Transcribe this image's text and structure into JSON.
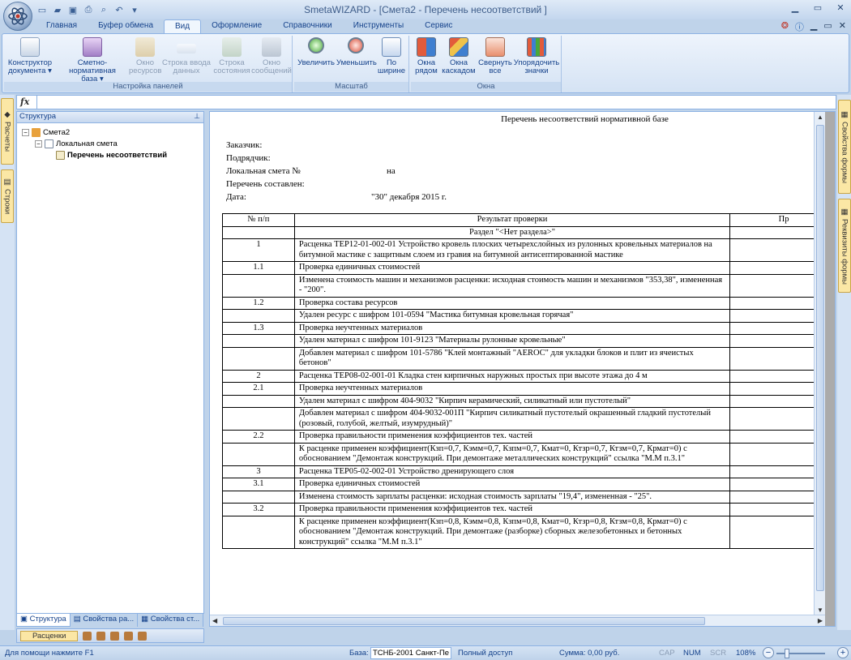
{
  "app": {
    "title": "SmetaWIZARD - [Смета2 - Перечень несоответствий ]"
  },
  "ribbon_tabs": [
    "Главная",
    "Буфер обмена",
    "Вид",
    "Оформление",
    "Справочники",
    "Инструменты",
    "Сервис"
  ],
  "ribbon": {
    "panels_group": {
      "label": "Настройка панелей",
      "buttons": [
        {
          "line1": "Конструктор",
          "line2": "документа ▾"
        },
        {
          "line1": "Сметно-нормативная",
          "line2": "база ▾"
        },
        {
          "line1": "Окно",
          "line2": "ресурсов"
        },
        {
          "line1": "Строка ввода",
          "line2": "данных"
        },
        {
          "line1": "Строка",
          "line2": "состояния"
        },
        {
          "line1": "Окно",
          "line2": "сообщений"
        }
      ]
    },
    "scale_group": {
      "label": "Масштаб",
      "buttons": [
        {
          "line1": "Увеличить",
          "line2": ""
        },
        {
          "line1": "Уменьшить",
          "line2": ""
        },
        {
          "line1": "По",
          "line2": "ширине"
        }
      ]
    },
    "windows_group": {
      "label": "Окна",
      "buttons": [
        {
          "line1": "Окна",
          "line2": "рядом"
        },
        {
          "line1": "Окна",
          "line2": "каскадом"
        },
        {
          "line1": "Свернуть",
          "line2": "все"
        },
        {
          "line1": "Упорядочить",
          "line2": "значки"
        }
      ]
    }
  },
  "formula_bar": {
    "fx": "fx"
  },
  "side_tabs": {
    "left": [
      "Расчеты",
      "Строки"
    ],
    "right": [
      "Свойства формы",
      "Реквизиты формы"
    ]
  },
  "structure_panel": {
    "title": "Структура",
    "tree": [
      {
        "label": "Смета2"
      },
      {
        "label": "Локальная смета"
      },
      {
        "label": "Перечень несоответствий"
      }
    ],
    "bottom_tabs": [
      "Структура",
      "Свойства ра...",
      "Свойства ст..."
    ],
    "rascenki": "Расценки"
  },
  "document": {
    "title": "Перечень несоответствий нормативной базе",
    "meta": {
      "zakazchik": "Заказчик:",
      "podryadchik": "Подрядчик:",
      "smeta": "Локальная смета №",
      "na": "на",
      "sostavlen": "Перечень составлен:",
      "date_label": "Дата:",
      "date_value": "\"30\" декабря 2015 г."
    },
    "columns": [
      "№ п/п",
      "Результат проверки",
      "Пр"
    ],
    "rows": [
      {
        "n": "",
        "text": "Раздел \"<Нет раздела>\"",
        "center": true
      },
      {
        "n": "1",
        "text": "Расценка ТЕР12-01-002-01 Устройство кровель плоских четырехслойных из рулонных кровельных материалов на битумной мастике с защитным слоем из гравия на битумной антисептированной мастике"
      },
      {
        "n": "1.1",
        "text": "Проверка единичных стоимостей"
      },
      {
        "n": "",
        "text": "Изменена стоимость машин и механизмов расценки: исходная стоимость машин и механизмов \"353,38\", измененная - \"200\"."
      },
      {
        "n": "1.2",
        "text": "Проверка состава ресурсов"
      },
      {
        "n": "",
        "text": "Удален ресурс с шифром 101-0594 \"Мастика битумная кровельная горячая\""
      },
      {
        "n": "1.3",
        "text": "Проверка неучтенных материалов"
      },
      {
        "n": "",
        "text": "Удален материал с шифром 101-9123 \"Материалы рулонные кровельные\""
      },
      {
        "n": "",
        "text": "Добавлен материал с шифром 101-5786 \"Клей монтажный \"AEROC\" для укладки блоков и плит из ячеистых бетонов\""
      },
      {
        "n": "2",
        "text": "Расценка ТЕР08-02-001-01 Кладка стен кирпичных наружных простых при высоте этажа до 4 м"
      },
      {
        "n": "2.1",
        "text": "Проверка неучтенных материалов"
      },
      {
        "n": "",
        "text": "Удален материал с шифром 404-9032 \"Кирпич керамический, силикатный или пустотелый\""
      },
      {
        "n": "",
        "text": "Добавлен материал с шифром 404-9032-001П \"Кирпич силикатный пустотелый окрашенный гладкий пустотелый (розовый, голубой, желтый, изумрудный)\""
      },
      {
        "n": "2.2",
        "text": "Проверка правильности применения коэффициентов тех. частей"
      },
      {
        "n": "",
        "text": "К расценке применен коэффициент(Кзп=0,7, Кэмм=0,7, Кзпм=0,7, Кмат=0, Ктзр=0,7, Ктзм=0,7, Крмат=0) с обоснованием \"Демонтаж конструкций. При демонтаже металлических конструкций\" ссылка \"М.М п.3.1\""
      },
      {
        "n": "3",
        "text": "Расценка ТЕР05-02-002-01 Устройство дренирующего слоя"
      },
      {
        "n": "3.1",
        "text": "Проверка единичных стоимостей"
      },
      {
        "n": "",
        "text": "Изменена стоимость зарплаты расценки: исходная стоимость зарплаты \"19,4\", измененная - \"25\"."
      },
      {
        "n": "3.2",
        "text": "Проверка правильности применения коэффициентов тех. частей"
      },
      {
        "n": "",
        "text": "К расценке применен коэффициент(Кзп=0,8, Кэмм=0,8, Кзпм=0,8, Кмат=0, Ктзр=0,8, Ктзм=0,8, Крмат=0) с обоснованием \"Демонтаж конструкций. При демонтаже (разборке) сборных железобетонных и бетонных конструкций\" ссылка \"М.М п.3.1\""
      }
    ]
  },
  "status": {
    "help": "Для помощи нажмите F1",
    "base_label": "База:",
    "base_value": "ТСНБ-2001 Санкт-Пе",
    "access": "Полный доступ",
    "sum": "Сумма: 0,00 руб.",
    "cap": "CAP",
    "num": "NUM",
    "scr": "SCR",
    "zoom": "108%"
  },
  "colors": {
    "accent": "#15428b",
    "ribbon_bg": "#d5e3f4",
    "tab_yellow": "#fbe7a5"
  }
}
